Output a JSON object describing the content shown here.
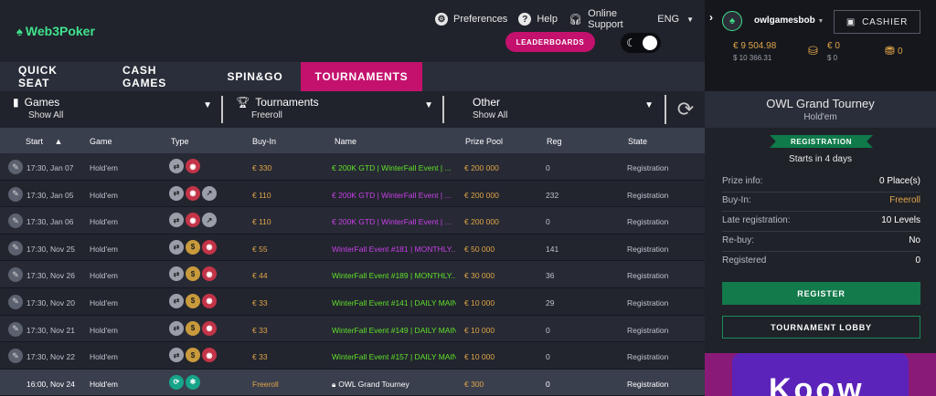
{
  "brand": {
    "logo_text": "Web3Poker"
  },
  "topnav": {
    "preferences": "Preferences",
    "help": "Help",
    "online_support": "Online Support",
    "language": "ENG"
  },
  "leaderboards": "LEADERBOARDS",
  "tabs": [
    "QUICK SEAT",
    "CASH GAMES",
    "SPIN&GO",
    "TOURNAMENTS"
  ],
  "active_tab": "TOURNAMENTS",
  "filters": [
    {
      "title": "Games",
      "value": "Show All"
    },
    {
      "title": "Tournaments",
      "value": "Freeroll"
    },
    {
      "title": "Other",
      "value": "Show All"
    }
  ],
  "columns": {
    "start": "Start",
    "game": "Game",
    "type": "Type",
    "buyin": "Buy-In",
    "name": "Name",
    "prize": "Prize Pool",
    "reg": "Reg",
    "state": "State"
  },
  "rows": [
    {
      "start": "17:30, Jan 07",
      "game": "Hold'em",
      "buyin": "€ 330",
      "name": "€ 200K  GTD  | WinterFall Event | ...",
      "name_color": "#60e029",
      "prize": "€ 200 000",
      "reg": "0",
      "state": "Registration"
    },
    {
      "start": "17:30, Jan 05",
      "game": "Hold'em",
      "buyin": "€ 110",
      "name": "€ 200K  GTD  | WinterFall Event | ...",
      "name_color": "#c840e8",
      "prize": "€ 200 000",
      "reg": "232",
      "state": "Registration"
    },
    {
      "start": "17:30, Jan 06",
      "game": "Hold'em",
      "buyin": "€ 110",
      "name": "€ 200K  GTD  | WinterFall Event | ...",
      "name_color": "#c840e8",
      "prize": "€ 200 000",
      "reg": "0",
      "state": "Registration"
    },
    {
      "start": "17:30, Nov 25",
      "game": "Hold'em",
      "buyin": "€ 55",
      "name": "WinterFall Event #181 | MONTHLY...",
      "name_color": "#c840e8",
      "prize": "€ 50 000",
      "reg": "141",
      "state": "Registration"
    },
    {
      "start": "17:30, Nov 26",
      "game": "Hold'em",
      "buyin": "€ 44",
      "name": "WinterFall Event #189 | MONTHLY...",
      "name_color": "#60e029",
      "prize": "€ 30 000",
      "reg": "36",
      "state": "Registration"
    },
    {
      "start": "17:30, Nov 20",
      "game": "Hold'em",
      "buyin": "€ 33",
      "name": "WinterFall Event #141 | DAILY MAIN",
      "name_color": "#60e029",
      "prize": "€ 10 000",
      "reg": "29",
      "state": "Registration"
    },
    {
      "start": "17:30, Nov 21",
      "game": "Hold'em",
      "buyin": "€ 33",
      "name": "WinterFall Event #149 | DAILY MAIN",
      "name_color": "#60e029",
      "prize": "€ 10 000",
      "reg": "0",
      "state": "Registration"
    },
    {
      "start": "17:30, Nov 22",
      "game": "Hold'em",
      "buyin": "€ 33",
      "name": "WinterFall Event #157 | DAILY MAIN",
      "name_color": "#60e029",
      "prize": "€ 10 000",
      "reg": "0",
      "state": "Registration"
    },
    {
      "start": "16:00, Nov 24",
      "game": "Hold'em",
      "buyin": "Freeroll",
      "name": "OWL Grand Tourney",
      "name_color": "#ffffff",
      "prize": "€ 300",
      "reg": "0",
      "state": "Registration"
    }
  ],
  "user": {
    "name": "owlgamesbob",
    "cashier": "CASHIER",
    "balance": "€ 9 504.98",
    "balance_sub": "$ 10 366.31",
    "bonus": "€ 0",
    "bonus_sub": "$ 0",
    "tokens": "0"
  },
  "detail": {
    "title": "OWL Grand Tourney",
    "game": "Hold'em",
    "badge": "REGISTRATION",
    "starts": "Starts in 4 days",
    "prize_label": "Prize info:",
    "prize_value": "0 Place(s)",
    "buyin_label": "Buy-In:",
    "buyin_value": "Freeroll",
    "late_label": "Late registration:",
    "late_value": "10 Levels",
    "rebuy_label": "Re-buy:",
    "rebuy_value": "No",
    "registered_label": "Registered",
    "registered_value": "0",
    "register_btn": "REGISTER",
    "lobby_btn": "TOURNAMENT LOBBY"
  },
  "promo": {
    "text": "Koow"
  }
}
